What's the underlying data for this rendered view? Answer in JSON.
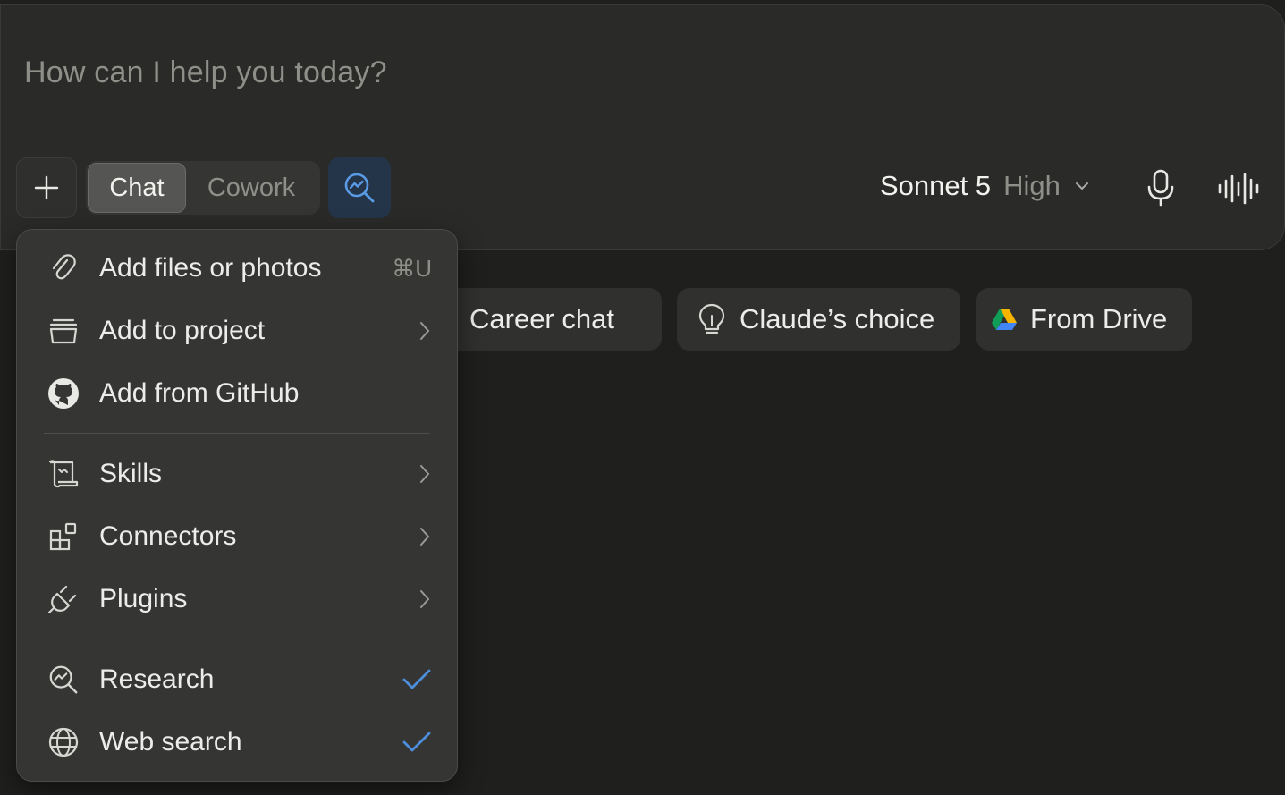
{
  "composer": {
    "placeholder": "How can I help you today?",
    "modes": [
      "Chat",
      "Cowork"
    ],
    "active_mode": "Chat",
    "model_name": "Sonnet 5",
    "model_effort": "High"
  },
  "suggestions": [
    {
      "label": "Career chat",
      "icon": "clipboard-icon"
    },
    {
      "label": "Claude’s choice",
      "icon": "lightbulb-icon"
    },
    {
      "label": "From Drive",
      "icon": "google-drive-icon"
    }
  ],
  "menu": {
    "items": [
      {
        "label": "Add files or photos",
        "icon": "paperclip-icon",
        "shortcut": "⌘U"
      },
      {
        "label": "Add to project",
        "icon": "project-box-icon",
        "submenu": true
      },
      {
        "label": "Add from GitHub",
        "icon": "github-icon"
      },
      {
        "label": "Skills",
        "icon": "scroll-icon",
        "submenu": true
      },
      {
        "label": "Connectors",
        "icon": "grid-plus-icon",
        "submenu": true
      },
      {
        "label": "Plugins",
        "icon": "plug-icon",
        "submenu": true
      },
      {
        "label": "Research",
        "icon": "research-icon",
        "checked": true
      },
      {
        "label": "Web search",
        "icon": "globe-icon",
        "checked": true
      }
    ]
  },
  "colors": {
    "accent_check": "#4d8fdc",
    "research_bg": "#24354a"
  }
}
